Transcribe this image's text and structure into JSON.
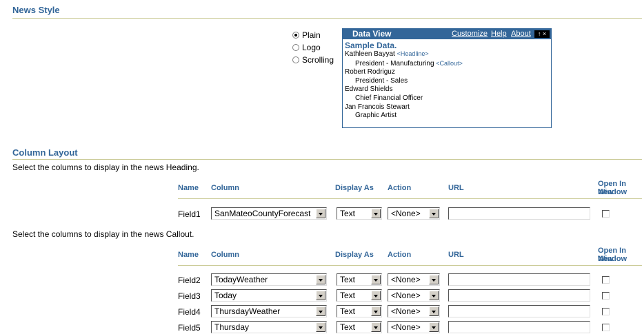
{
  "news_style": {
    "title": "News Style",
    "options": [
      {
        "label": "Plain",
        "checked": true
      },
      {
        "label": "Logo",
        "checked": false
      },
      {
        "label": "Scrolling",
        "checked": false
      }
    ]
  },
  "data_view": {
    "title": "Data View",
    "links": {
      "customize": "Customize",
      "help": "Help",
      "about": "About"
    },
    "controls": "↑ ×",
    "sample_heading": "Sample Data.",
    "entries": [
      {
        "name": "Kathleen Bayyat",
        "name_tag": "<Headline>",
        "role": "President - Manufacturing",
        "role_tag": "<Callout>"
      },
      {
        "name": "Robert Rodriguz",
        "name_tag": "",
        "role": "President - Sales",
        "role_tag": ""
      },
      {
        "name": "Edward Shields",
        "name_tag": "",
        "role": "Chief Financial Officer",
        "role_tag": ""
      },
      {
        "name": "Jan Francois Stewart",
        "name_tag": "",
        "role": "Graphic Artist",
        "role_tag": ""
      }
    ]
  },
  "column_layout": {
    "title": "Column Layout",
    "heading_instruction": "Select the columns to display in the news Heading.",
    "callout_instruction": "Select the columns to display in the news Callout.",
    "headers": {
      "name": "Name",
      "column": "Column",
      "display_as": "Display As",
      "action": "Action",
      "url": "URL",
      "open_new_1": "Open In New",
      "open_new_2": "Window"
    },
    "heading_rows": [
      {
        "name": "Field1",
        "column": "SanMateoCountyForecast",
        "display_as": "Text",
        "action": "<None>",
        "url": ""
      }
    ],
    "callout_rows": [
      {
        "name": "Field2",
        "column": "TodayWeather",
        "display_as": "Text",
        "action": "<None>",
        "url": ""
      },
      {
        "name": "Field3",
        "column": "Today",
        "display_as": "Text",
        "action": "<None>",
        "url": ""
      },
      {
        "name": "Field4",
        "column": "ThursdayWeather",
        "display_as": "Text",
        "action": "<None>",
        "url": ""
      },
      {
        "name": "Field5",
        "column": "Thursday",
        "display_as": "Text",
        "action": "<None>",
        "url": ""
      }
    ]
  }
}
